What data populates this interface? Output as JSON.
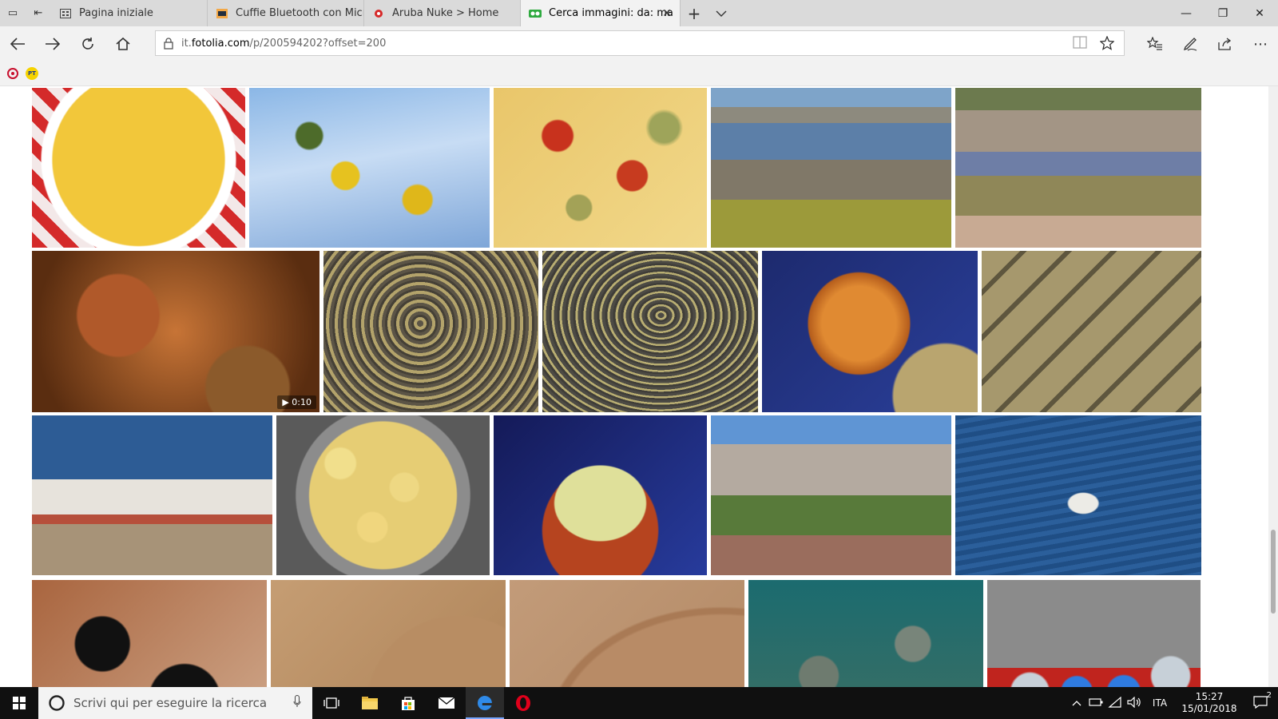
{
  "tabs": [
    {
      "label": "Pagina iniziale",
      "active": false,
      "favicon": "grid-icon"
    },
    {
      "label": "Cuffie Bluetooth con Microf",
      "active": false,
      "favicon": "amazon-icon"
    },
    {
      "label": "Aruba Nuke > Home",
      "active": false,
      "favicon": "aruba-icon"
    },
    {
      "label": "Cerca immagini: da: ma",
      "active": true,
      "favicon": "fotolia-icon"
    }
  ],
  "address": {
    "prefix": "it.",
    "domain": "fotolia.com",
    "path": "/p/200594202?offset=200"
  },
  "favorites": [
    {
      "icon": "nuke-icon",
      "color": "#c8102e",
      "label": ""
    },
    {
      "icon": "poste-icon",
      "color": "#f6d300",
      "label": "PT"
    }
  ],
  "gallery": {
    "rows": [
      [
        {
          "name": "pasta-shells",
          "w": 267,
          "bg": "radial-gradient(circle at 50% 45%, #f2c73a 0 62%, #fff 63% 70%, transparent 71%), repeating-linear-gradient(45deg, #d42a2a 0 14px, #f3e8e8 14px 28px)"
        },
        {
          "name": "mimosa-sky",
          "w": 301,
          "bg": "radial-gradient(circle at 40% 55%, #e6c21f 0 8%, transparent 9%), radial-gradient(circle at 70% 70%, #dfb71a 0 7%, transparent 8%), radial-gradient(circle at 25% 30%, #4d6b2a 0 6%, transparent 7%), linear-gradient(170deg, #8bb7e6 0%, #c7dcf4 45%, #7ea6d8 100%)"
        },
        {
          "name": "focaccia-tomatoes",
          "w": 267,
          "bg": "radial-gradient(circle at 30% 30%, #c8321d 0 8%, transparent 9%), radial-gradient(circle at 65% 55%, #c73b1f 0 9%, transparent 10%), radial-gradient(circle at 40% 75%, #a3a257 0 7%, transparent 8%), radial-gradient(circle at 80% 25%, #9ea45a 0 7%, transparent 9%), linear-gradient(135deg, #e9c66a, #f1d88a)"
        },
        {
          "name": "rocky-coast-1",
          "w": 301,
          "bg": "linear-gradient(180deg, #7ea4c9 0 12%, #8d8a7e 12% 22%, #5c7fa8 22% 45%, #807868 45% 70%, #9c9a3a 70% 100%)"
        },
        {
          "name": "rocky-coast-2",
          "w": 308,
          "bg": "linear-gradient(180deg, #6c7a4e 0 14%, #a39585 14% 40%, #6e7ea6 40% 55%, #8f8758 55% 80%, #c8aa93 80% 100%)"
        }
      ],
      [
        {
          "name": "watch-gears",
          "w": 360,
          "bg": "radial-gradient(circle at 30% 40%, #b0592a 0 18%, transparent 19%), radial-gradient(circle at 75% 85%, #8b5a2b 0 16%, transparent 17%), radial-gradient(circle at 50% 50%, #c77436, #5a2d10 85%)",
          "video": "▶ 0:10"
        },
        {
          "name": "tree-rings-1",
          "w": 269,
          "bg": "repeating-radial-gradient(circle at 45% 45%, #5b5446 0 4px, #b3a36b 4px 8px, #454036 8px 11px)"
        },
        {
          "name": "tree-rings-2",
          "w": 270,
          "bg": "repeating-radial-gradient(ellipse at 55% 40%, #4c4a44 0 4px, #b8ad72 4px 7px, #3f3d38 7px 10px)"
        },
        {
          "name": "onion",
          "w": 270,
          "bg": "radial-gradient(circle at 45% 45%, #e08a32 0 25%, #b55d1c 34%, transparent 35%), radial-gradient(circle at 85% 90%, #b9a56f 0 22%, transparent 23%), linear-gradient(135deg, #1d2a6e, #2a3f9a)"
        },
        {
          "name": "wooden-boards",
          "w": 275,
          "bg": "repeating-linear-gradient(135deg, #a6986d 0 34px, #5e563e 34px 40px)"
        }
      ],
      [
        {
          "name": "old-boat",
          "w": 301,
          "bg": "linear-gradient(180deg, #2d5c95 0 40%, transparent 40%), linear-gradient(180deg, transparent 0 40%, #e7e3dc 40% 62%, #b64f3b 62% 68%, #a79378 68% 100%)"
        },
        {
          "name": "potatoes-steamer",
          "w": 267,
          "bg": "radial-gradient(circle at 30% 30%, #f1df8c 0 8%, transparent 9%), radial-gradient(circle at 60% 45%, #eed883 0 9%, transparent 10%), radial-gradient(circle at 45% 70%, #f0d67e 0 9%, transparent 10%), radial-gradient(circle at 50% 50%, #e6cd74 0 55%, #8c8c8c 56% 65%, #5a5a5a 66%)"
        },
        {
          "name": "potatoes-bowl",
          "w": 267,
          "bg": "radial-gradient(ellipse at 50% 55%, #dfe09a 0 30%, transparent 31%), radial-gradient(ellipse at 50% 72%, #b6441f 0 38%, transparent 39%), linear-gradient(135deg, #141a58, #273b9c)"
        },
        {
          "name": "mountain-path",
          "w": 301,
          "bg": "linear-gradient(180deg, #5f95d4 0 18%, #b4aaa0 18% 50%, #587a3a 50% 75%, #9a6d5d 75% 100%)"
        },
        {
          "name": "fishing-boat-sea",
          "w": 308,
          "bg": "radial-gradient(ellipse at 52% 55%, #ecebe6 0 8%, transparent 9%), repeating-linear-gradient(170deg, #1f4e85 0 6px, #2b5f9b 6px 12px)"
        }
      ],
      [
        {
          "name": "rock-holes",
          "w": 294,
          "bg": "radial-gradient(circle at 30% 40%, #111 0 14%, transparent 15%), radial-gradient(circle at 65% 75%, #111 0 18%, transparent 19%), linear-gradient(135deg, #a9653f, #cfa78a)"
        },
        {
          "name": "sand-curve-1",
          "w": 294,
          "bg": "radial-gradient(circle at 80% 80%, #b88d63 0 40%, transparent 41%), linear-gradient(135deg, #c59d73, #ad8257)"
        },
        {
          "name": "sand-curve-2",
          "w": 294,
          "bg": "radial-gradient(ellipse at 90% 100%, #b88b66 0 55%, #a97a55 56% 58%, transparent 59%), linear-gradient(135deg, #c29b79, #b28864)"
        },
        {
          "name": "seabed-stones",
          "w": 294,
          "bg": "radial-gradient(circle at 30% 60%, #6e7b6f 0 10%, transparent 11%), radial-gradient(circle at 70% 40%, #78857a 0 9%, transparent 10%), linear-gradient(180deg, #1b6b6f, #3e6f63)"
        },
        {
          "name": "car-lights",
          "w": 267,
          "bg": "radial-gradient(circle at 20% 70%, #c7d0d8 0 9%, transparent 10%), radial-gradient(circle at 42% 70%, #2f7be0 0 9%, transparent 10%), radial-gradient(circle at 64% 70%, #2f7be0 0 9%, transparent 10%), radial-gradient(circle at 86% 60%, #c7d0d8 0 9%, transparent 10%), linear-gradient(180deg, #8b8b8b 0 55%, #c0241e 55% 100%)"
        }
      ]
    ],
    "row_tops": [
      2,
      206,
      412,
      618
    ],
    "row_heights": [
      200,
      202,
      200,
      200
    ]
  },
  "taskbar": {
    "search_placeholder": "Scrivi qui per eseguire la ricerca",
    "language": "ITA",
    "time": "15:27",
    "date": "15/01/2018",
    "notification_count": "2"
  }
}
